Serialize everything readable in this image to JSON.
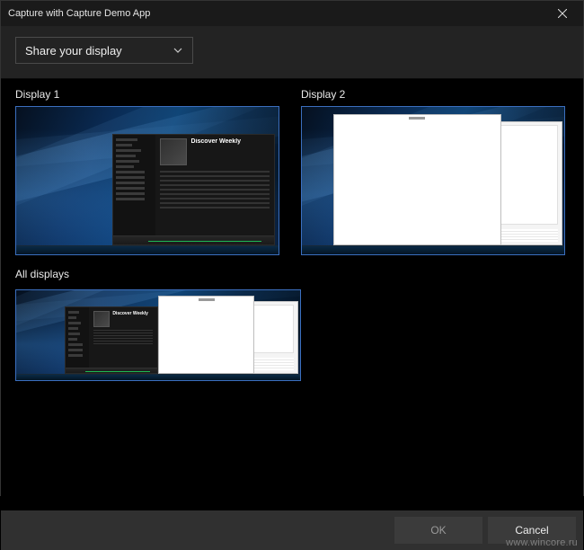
{
  "window": {
    "title": "Capture with Capture Demo App"
  },
  "dropdown": {
    "label": "Share your display"
  },
  "displays": {
    "items": [
      {
        "label": "Display 1"
      },
      {
        "label": "Display 2"
      }
    ],
    "allLabel": "All displays"
  },
  "spotifyWindow": {
    "heading": "Discover Weekly"
  },
  "footer": {
    "ok": "OK",
    "cancel": "Cancel"
  },
  "watermark": "www.wincore.ru"
}
